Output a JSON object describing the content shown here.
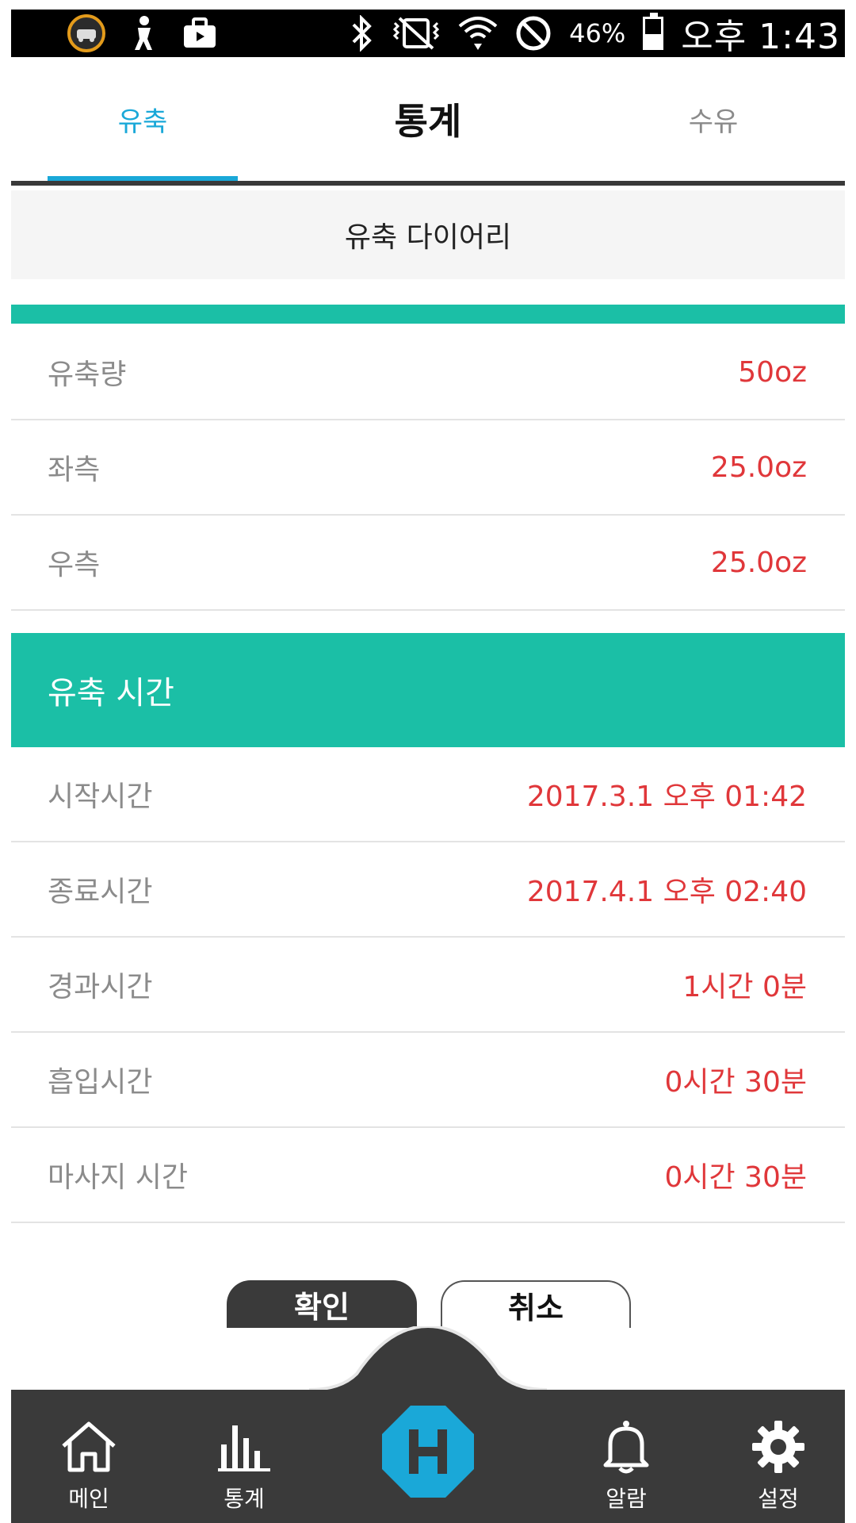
{
  "status_bar": {
    "battery_percent": "46%",
    "time": "오후 1:43",
    "icons": [
      "car-app-icon",
      "person-icon",
      "briefcase-icon",
      "bluetooth-icon",
      "vibrate-mute-icon",
      "wifi-icon",
      "do-not-disturb-icon",
      "battery-icon"
    ]
  },
  "tabs": {
    "left": "유축",
    "center": "통계",
    "right": "수유"
  },
  "subheader": "유축 다이어리",
  "amount_rows": [
    {
      "label": "유축량",
      "value": "50oz"
    },
    {
      "label": "좌측",
      "value": "25.0oz"
    },
    {
      "label": "우측",
      "value": "25.0oz"
    }
  ],
  "time_section": {
    "title": "유축 시간",
    "rows": [
      {
        "label": "시작시간",
        "value": "2017.3.1 오후 01:42"
      },
      {
        "label": "종료시간",
        "value": "2017.4.1 오후 02:40"
      },
      {
        "label": "경과시간",
        "value": "1시간 0분"
      },
      {
        "label": "흡입시간",
        "value": "0시간 30분"
      },
      {
        "label": "마사지 시간",
        "value": "0시간 30분"
      }
    ]
  },
  "buttons": {
    "confirm": "확인",
    "cancel": "취소"
  },
  "bottom_nav": {
    "main": "메인",
    "stats": "통계",
    "alarm": "알람",
    "settings": "설정"
  },
  "colors": {
    "accent_teal": "#1bbfa6",
    "tab_blue": "#1aa8d8",
    "value_red": "#e0373a",
    "nav_dark": "#3a3a3a"
  }
}
